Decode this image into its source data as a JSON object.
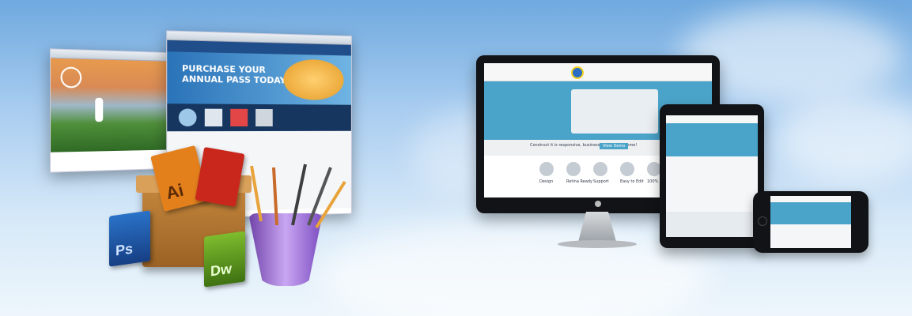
{
  "colors": {
    "sky_top": "#6fa9df",
    "sky_bottom": "#eef6fc",
    "device_black": "#111316",
    "site_accent": "#4aa3c8",
    "nav_blue": "#1f4e8a",
    "ps_blue": "#1b57a8",
    "dw_green": "#5e9a1e",
    "ai_orange": "#e4801c",
    "pdf_red": "#c9271c"
  },
  "left_browser_front": {
    "hero_line1": "PURCHASE YOUR",
    "hero_line2": "ANNUAL PASS TODAY"
  },
  "icons": {
    "ps_label": "Ps",
    "dw_label": "Dw",
    "ai_label": "Ai",
    "ps_icon": "photoshop-icon",
    "dw_icon": "dreamweaver-icon",
    "ai_icon": "illustrator-icon",
    "pdf_icon": "pdf-icon",
    "brushes_icon": "brush-cup-icon",
    "box_icon": "cardboard-box-icon"
  },
  "devices": {
    "monitor_caption": "Construct it is responsive, business wordpress theme!",
    "monitor_button": "View Demo",
    "services": [
      "Design",
      "Retina Ready",
      "Support",
      "Easy to Edit",
      "100% Ready"
    ]
  }
}
